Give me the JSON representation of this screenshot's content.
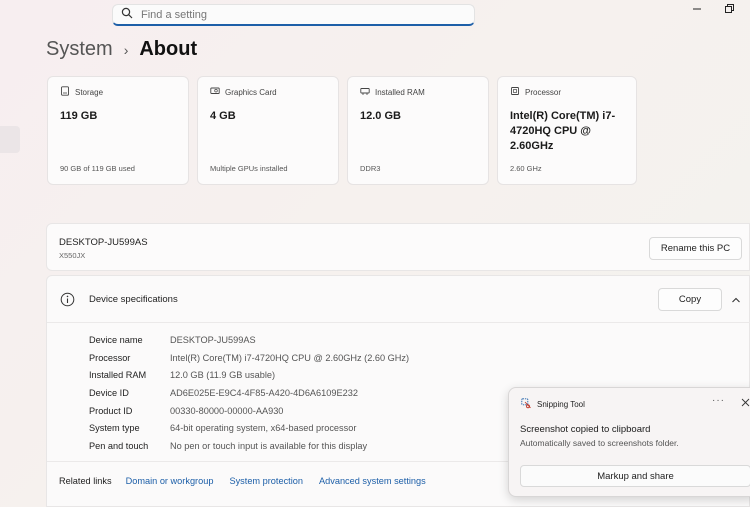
{
  "search": {
    "placeholder": "Find a setting"
  },
  "breadcrumb": {
    "parent": "System",
    "separator": "›",
    "current": "About"
  },
  "cards": [
    {
      "label": "Storage",
      "icon": "storage-icon",
      "value": "119 GB",
      "sub": "90 GB of 119 GB used"
    },
    {
      "label": "Graphics Card",
      "icon": "graphics-card-icon",
      "value": "4 GB",
      "sub": "Multiple GPUs installed"
    },
    {
      "label": "Installed RAM",
      "icon": "ram-icon",
      "value": "12.0 GB",
      "sub": "DDR3"
    },
    {
      "label": "Processor",
      "icon": "processor-icon",
      "value": "Intel(R) Core(TM) i7-4720HQ CPU @ 2.60GHz",
      "sub": "2.60 GHz"
    }
  ],
  "device": {
    "name": "DESKTOP-JU599AS",
    "model": "X550JX",
    "rename_label": "Rename this PC"
  },
  "specs": {
    "title": "Device specifications",
    "copy_label": "Copy",
    "rows": [
      {
        "key": "Device name",
        "value": "DESKTOP-JU599AS"
      },
      {
        "key": "Processor",
        "value": "Intel(R) Core(TM) i7-4720HQ CPU @ 2.60GHz (2.60 GHz)"
      },
      {
        "key": "Installed RAM",
        "value": "12.0 GB (11.9 GB usable)"
      },
      {
        "key": "Device ID",
        "value": "AD6E025E-E9C4-4F85-A420-4D6A6109E232"
      },
      {
        "key": "Product ID",
        "value": "00330-80000-00000-AA930"
      },
      {
        "key": "System type",
        "value": "64-bit operating system, x64-based processor"
      },
      {
        "key": "Pen and touch",
        "value": "No pen or touch input is available for this display"
      }
    ]
  },
  "related": {
    "label": "Related links",
    "links": [
      "Domain or workgroup",
      "System protection",
      "Advanced system settings"
    ]
  },
  "toast": {
    "app": "Snipping Tool",
    "more": "···",
    "title": "Screenshot copied to clipboard",
    "body": "Automatically saved to screenshots folder.",
    "action": "Markup and share"
  },
  "colors": {
    "accent": "#1d5fa8",
    "link": "#1d5fa8"
  }
}
